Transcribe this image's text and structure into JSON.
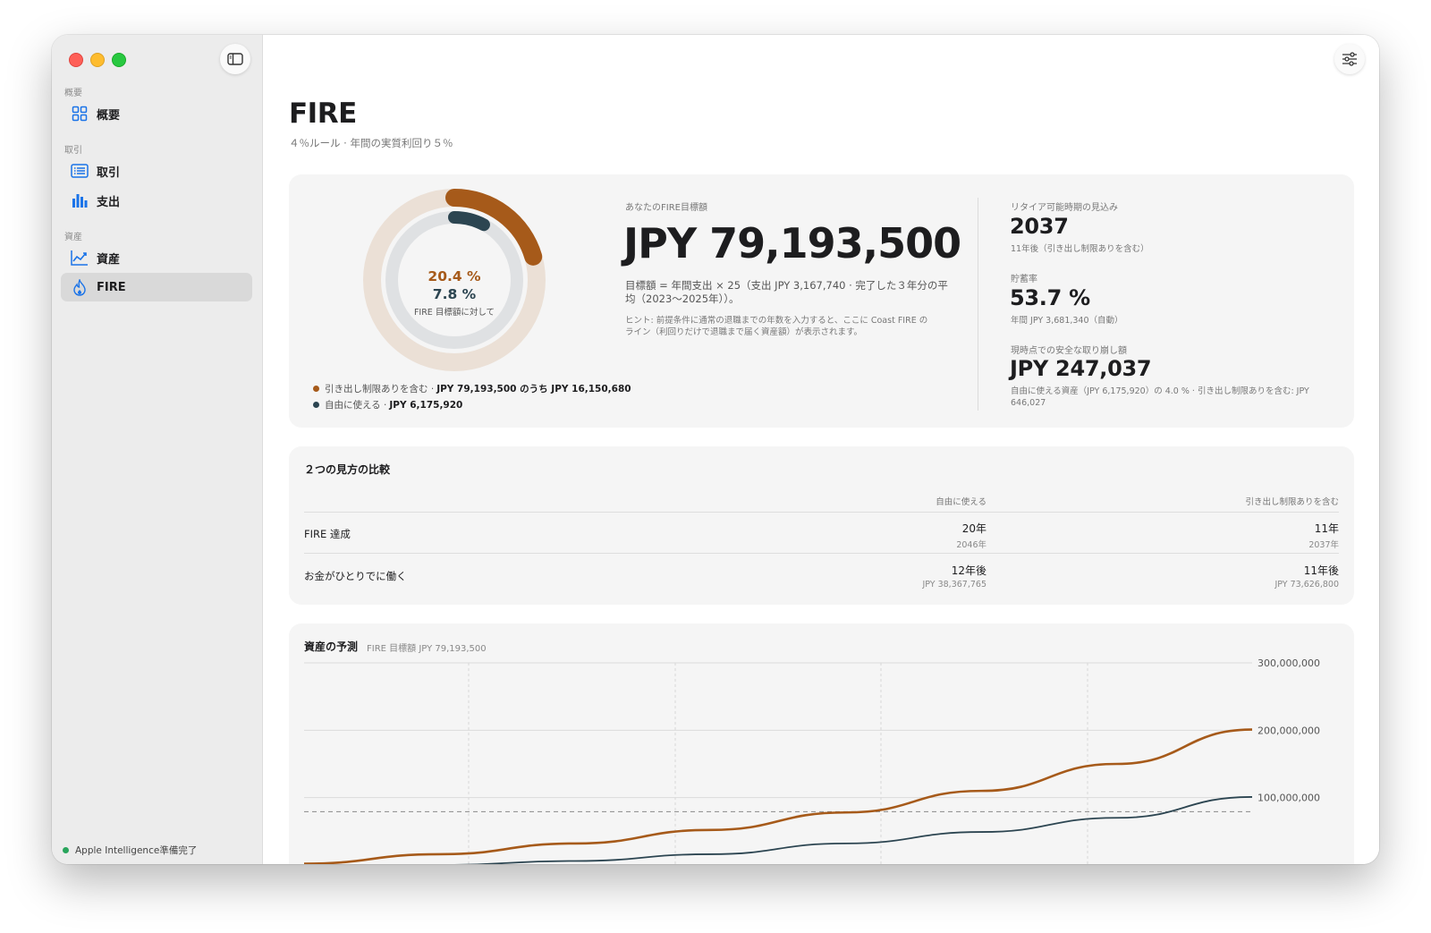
{
  "window": {
    "title": "FIRE"
  },
  "sidebar": {
    "sections": [
      "概要",
      "取引",
      "資産"
    ],
    "items": [
      {
        "label": "概要",
        "icon": "grid-icon"
      },
      {
        "label": "取引",
        "icon": "list-icon"
      },
      {
        "label": "支出",
        "icon": "bar-chart-icon"
      },
      {
        "label": "資産",
        "icon": "line-chart-icon"
      },
      {
        "label": "FIRE",
        "icon": "flame-icon",
        "active": true
      }
    ],
    "status": "Apple Intelligence準備完了"
  },
  "header": {
    "title": "FIRE",
    "subtitle": "４％ルール · 年間の実質利回り５％"
  },
  "progress": {
    "pct_locked": "20.4 %",
    "pct_free": "7.8 %",
    "caption": "FIRE 目標額に対して",
    "locked_fraction": 0.204,
    "free_fraction": 0.078,
    "legend": [
      {
        "label": "引き出し制限ありを含む · ",
        "value": "JPY 79,193,500 のうち JPY 16,150,680",
        "color": "#a65a1a"
      },
      {
        "label": "自由に使える · ",
        "value": "JPY 6,175,920",
        "color": "#2c4551"
      }
    ]
  },
  "goal": {
    "caption": "あなたのFIRE目標額",
    "value": "JPY 79,193,500",
    "formula": "目標額 = 年間支出 × 25（支出 JPY 3,167,740 · 完了した３年分の平均（2023〜2025年））。",
    "hint": "ヒント: 前提条件に通常の退職までの年数を入力すると、ここに Coast FIRE のライン（利回りだけで退職まで届く資産額）が表示されます。"
  },
  "stats": [
    {
      "caption": "リタイア可能時期の見込み",
      "value": "2037",
      "sub": "11年後（引き出し制限ありを含む）"
    },
    {
      "caption": "貯蓄率",
      "value": "53.7 %",
      "sub": "年間 JPY 3,681,340（自動）"
    },
    {
      "caption": "現時点での安全な取り崩し額",
      "value": "JPY 247,037",
      "sub": "自由に使える資産（JPY 6,175,920）の 4.0 % · 引き出し制限ありを含む: JPY 646,027"
    }
  ],
  "comparison": {
    "title": "２つの見方の比較",
    "columns": [
      "自由に使える",
      "引き出し制限ありを含む"
    ],
    "rows": [
      {
        "label": "FIRE 達成",
        "free": {
          "main": "20年",
          "sub": "2046年"
        },
        "locked": {
          "main": "11年",
          "sub": "2037年"
        }
      },
      {
        "label": "お金がひとりでに働く",
        "free": {
          "main": "12年後",
          "sub": "JPY 38,367,765"
        },
        "locked": {
          "main": "11年後",
          "sub": "JPY 73,626,800"
        }
      }
    ]
  },
  "projection": {
    "title": "資産の予測",
    "subtitle": "FIRE 目標額 JPY 79,193,500"
  },
  "chart_data": {
    "type": "line",
    "y_ticks": [
      "300,000,000",
      "200,000,000",
      "100,000,000"
    ],
    "ylim": [
      0,
      300000000
    ],
    "target_line": 79193500,
    "series": [
      {
        "color": "#a65a1a",
        "x": [
          0,
          2,
          4,
          6,
          8,
          10,
          12,
          14
        ],
        "values": [
          2000000,
          16000000,
          32000000,
          52000000,
          78000000,
          110000000,
          150000000,
          201000000
        ]
      },
      {
        "color": "#2c4551",
        "x": [
          0,
          2,
          4,
          6,
          8,
          10,
          12,
          14
        ],
        "values": [
          -12000000,
          0,
          6000000,
          16000000,
          32000000,
          49000000,
          70000000,
          101000000
        ]
      }
    ],
    "grid": true
  }
}
